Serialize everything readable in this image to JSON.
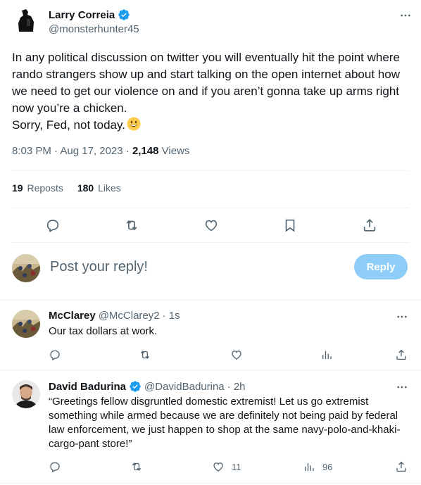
{
  "main_tweet": {
    "author_name": "Larry Correia",
    "author_handle": "@monsterhunter45",
    "text_line1": "In any political discussion on twitter you will eventually hit the point where rando strangers show up and start talking on the open internet about how we need to get our violence on and if you aren’t gonna take up arms right now you’re a chicken.",
    "text_line2": "Sorry, Fed, not today.",
    "time": "8:03 PM · Aug 17, 2023 · ",
    "views_count": "2,148",
    "views_label": " Views",
    "reposts_count": "19",
    "reposts_label": "Reposts",
    "likes_count": "180",
    "likes_label": "Likes"
  },
  "reply_box": {
    "placeholder": "Post your reply!",
    "button_label": "Reply"
  },
  "replies": [
    {
      "name": "McClarey",
      "handle": "@McClarey2",
      "time": "· 1s",
      "text": "Our tax dollars at work.",
      "likes": "",
      "views": ""
    },
    {
      "name": "David Badurina",
      "handle": "@DavidBadurina",
      "time": "· 2h",
      "text": "“Greetings fellow disgruntled domestic extremist! Let us go extremist something while armed because we are definitely not being paid by federal law enforcement, we just happen to shop at the same navy-polo-and-khaki-cargo-pant store!”",
      "likes": "11",
      "views": "96"
    }
  ],
  "colors": {
    "verified": "#1d9bf0",
    "secondary_text": "#536471",
    "reply_button": "#8ecdf8"
  }
}
